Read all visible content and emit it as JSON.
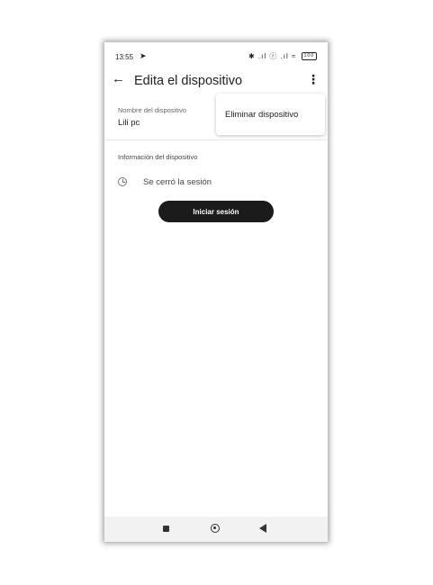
{
  "status_bar": {
    "time": "13:55",
    "icons_text": "✱ .ıl ⓡ .ıl ≈",
    "battery": "100"
  },
  "app_bar": {
    "title": "Edita el dispositivo"
  },
  "device_name": {
    "label": "Nombre del dispositivo",
    "value": "Lili pc"
  },
  "popup_menu": {
    "items": [
      "Eliminar dispositivo"
    ]
  },
  "device_info": {
    "section_title": "Información del dispositivo",
    "session_status": "Se cerró la sesión",
    "login_button": "Iniciar sesión"
  },
  "icons": [
    "send-icon",
    "back-arrow-icon",
    "more-vert-icon",
    "clock-icon",
    "recents-icon",
    "home-icon",
    "nav-back-icon"
  ],
  "colors": {
    "button_bg": "#1b1b1b",
    "button_text": "#ffffff",
    "navbar_bg": "#f2f2f2"
  }
}
